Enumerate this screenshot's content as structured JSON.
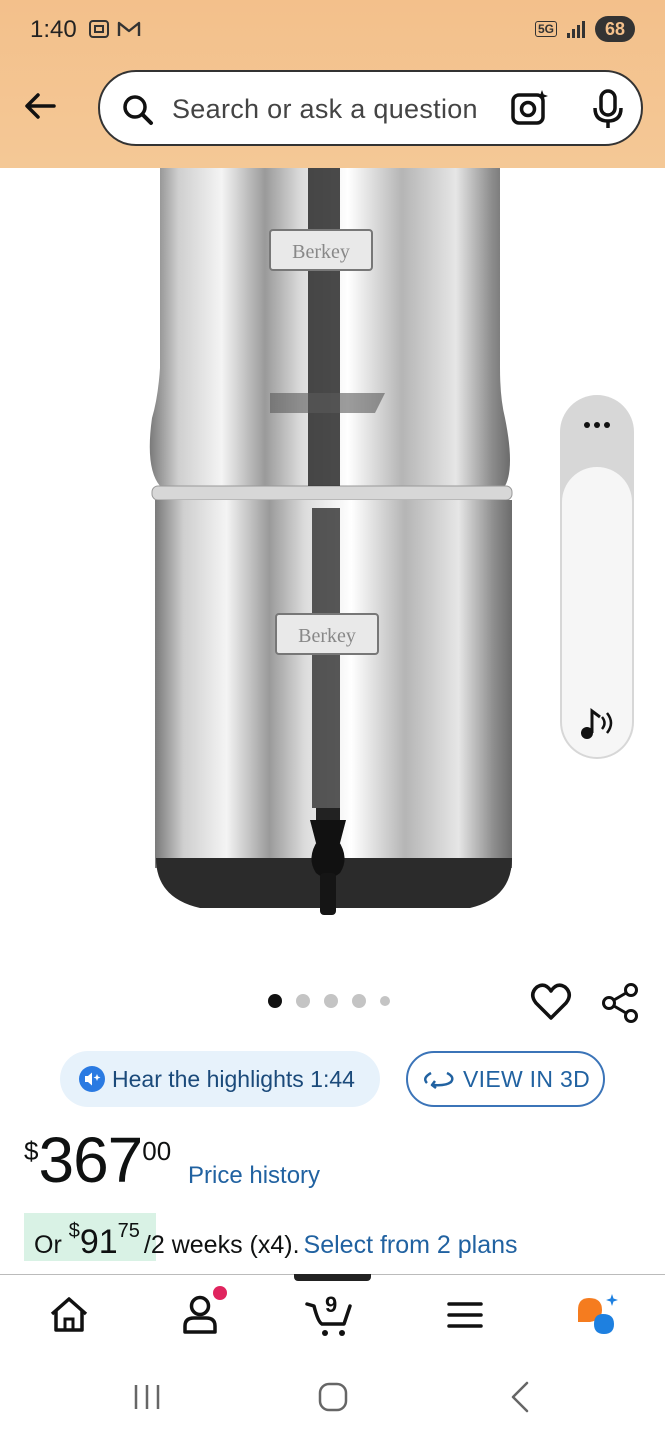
{
  "status_bar": {
    "time": "1:40",
    "network": "5G",
    "battery": "68"
  },
  "search": {
    "placeholder": "Search or ask a question"
  },
  "product": {
    "brand_mark": "Berkey",
    "image_count": 5,
    "active_image_index": 0
  },
  "actions": {
    "hear_highlights_label": "Hear the highlights 1:44",
    "view_in_3d_label": "VIEW IN 3D"
  },
  "price": {
    "symbol": "$",
    "whole": "367",
    "fraction": "00",
    "history_link": "Price history"
  },
  "installment": {
    "prefix": "Or ",
    "symbol": "$",
    "whole": "91",
    "fraction": "75",
    "period": "/2 weeks (x4).",
    "link": "Select from 2 plans"
  },
  "bottom_nav": {
    "cart_count": "9",
    "items": [
      "home-icon",
      "account-icon",
      "cart-icon",
      "menu-icon",
      "rufus-icon"
    ]
  },
  "colors": {
    "header_bg": "#f3c08b",
    "link": "#2162a1",
    "installment_highlight": "#d9f2e5",
    "hear_button_bg": "#e7f2fb"
  }
}
